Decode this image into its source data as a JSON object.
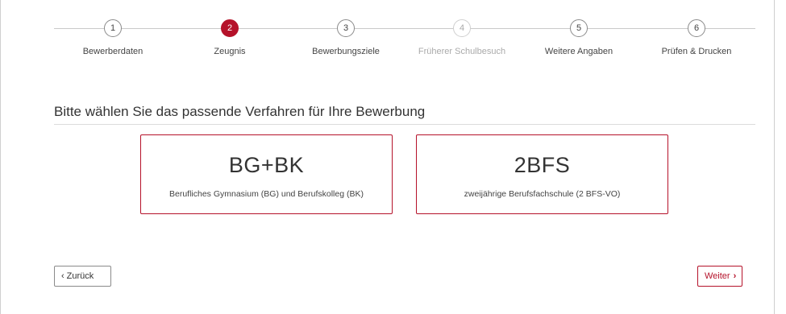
{
  "stepper": {
    "steps": [
      {
        "number": "1",
        "label": "Bewerberdaten",
        "state": "default"
      },
      {
        "number": "2",
        "label": "Zeugnis",
        "state": "active"
      },
      {
        "number": "3",
        "label": "Bewerbungsziele",
        "state": "default"
      },
      {
        "number": "4",
        "label": "Früherer Schulbesuch",
        "state": "disabled"
      },
      {
        "number": "5",
        "label": "Weitere Angaben",
        "state": "default"
      },
      {
        "number": "6",
        "label": "Prüfen & Drucken",
        "state": "default"
      }
    ]
  },
  "main": {
    "heading": "Bitte wählen Sie das passende Verfahren für Ihre Bewerbung",
    "options": [
      {
        "title": "BG+BK",
        "subtitle": "Berufliches Gymnasium (BG) und Berufskolleg (BK)"
      },
      {
        "title": "2BFS",
        "subtitle": "zweijährige Berufsfachschule (2 BFS-VO)"
      }
    ]
  },
  "nav": {
    "back_label": "Zurück",
    "next_label": "Weiter",
    "back_icon": "chevron-left-icon",
    "next_icon": "chevron-right-icon"
  },
  "colors": {
    "accent": "#b5122a",
    "border": "#8a8a8a",
    "disabled": "#aaaaaa"
  }
}
